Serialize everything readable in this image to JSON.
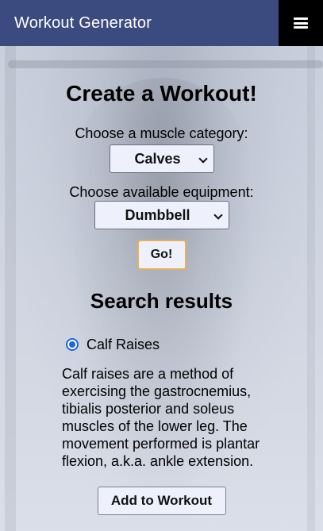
{
  "header": {
    "title": "Workout Generator",
    "menu_icon": "hamburger-menu-icon"
  },
  "main": {
    "heading": "Create a Workout!",
    "muscle_label": "Choose a muscle category:",
    "muscle_selected": "Calves",
    "equipment_label": "Choose available equipment:",
    "equipment_selected": "Dumbbell",
    "go_label": "Go!"
  },
  "results": {
    "heading": "Search results",
    "items": [
      {
        "name": "Calf Raises",
        "selected": true,
        "description": "Calf raises are a method of exercising the gastrocnemius, tibialis posterior and soleus muscles of the lower leg. The movement performed is plantar flexion, a.k.a. ankle extension."
      }
    ],
    "add_label": "Add to Workout"
  },
  "colors": {
    "header_bg": "#3c4b7f",
    "menu_bg": "#000000",
    "accent": "#1d66d7",
    "go_border": "#e7b15c"
  }
}
